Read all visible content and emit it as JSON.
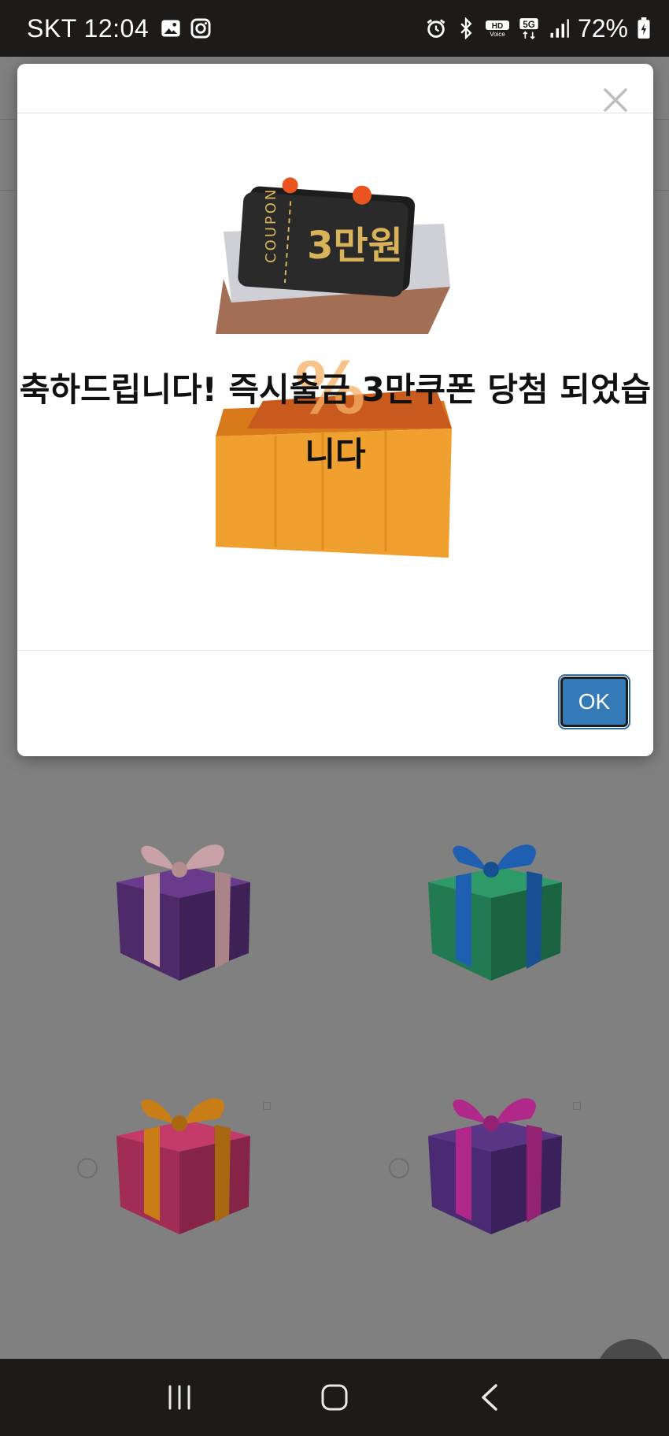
{
  "status_bar": {
    "carrier_time": "SKT 12:04",
    "battery": "72%",
    "icons": [
      "gallery-icon",
      "instagram-icon",
      "alarm-icon",
      "bluetooth-icon",
      "hd-voice-icon",
      "5g-icon",
      "signal-icon",
      "battery-icon"
    ]
  },
  "modal": {
    "close_icon": "close-icon",
    "image": {
      "coupon_label": "COUPON",
      "coupon_amount": "3만원"
    },
    "message": "축하드립니다! 즉시출금 3만쿠폰 당첨 되었습니다",
    "ok_label": "OK"
  },
  "background": {
    "gifts": [
      {
        "name": "gift-purple-pink",
        "box": "#5b3079",
        "ribbon": "#c8a2a6"
      },
      {
        "name": "gift-green-blue",
        "box": "#22855a",
        "ribbon": "#1e5fb1"
      },
      {
        "name": "gift-red-orange",
        "box": "#b22f5b",
        "ribbon": "#c87d17"
      },
      {
        "name": "gift-purple-magenta",
        "box": "#5b3079",
        "ribbon": "#b0288a"
      }
    ]
  },
  "nav_bar": {
    "icons": [
      "recent-apps-icon",
      "home-icon",
      "back-icon"
    ]
  }
}
